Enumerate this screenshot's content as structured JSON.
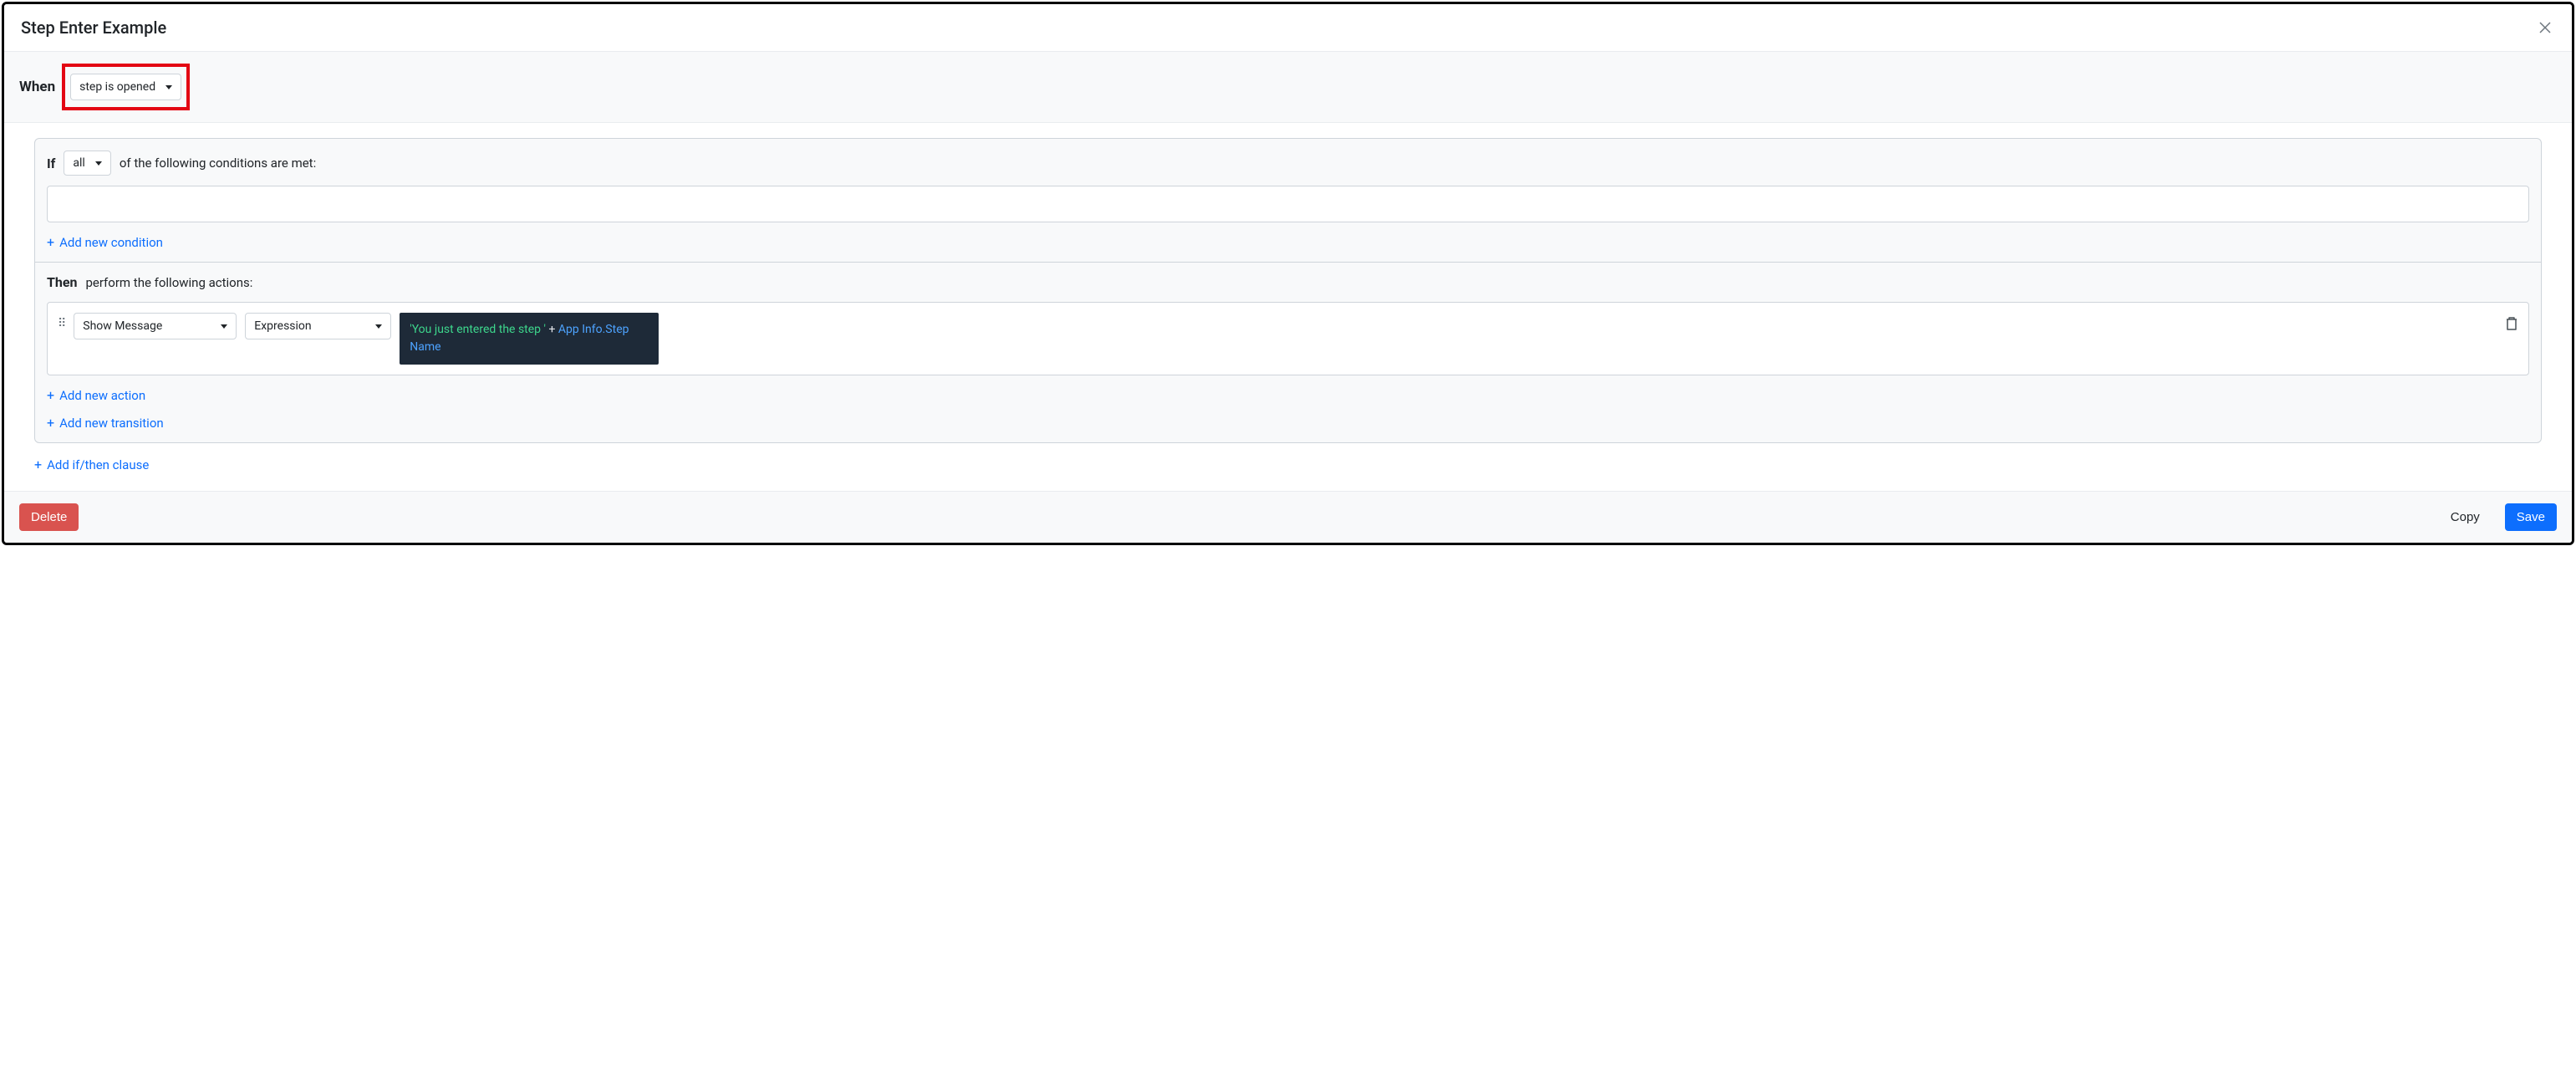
{
  "header": {
    "title": "Step Enter Example"
  },
  "when": {
    "label": "When",
    "trigger": "step is opened"
  },
  "clause": {
    "if_label": "If",
    "if_quantifier": "all",
    "if_suffix": "of the following conditions are met:",
    "add_condition": "Add new condition",
    "then_label": "Then",
    "then_suffix": "perform the following actions:",
    "action": {
      "type": "Show Message",
      "mode": "Expression",
      "expr_string": "'You just entered the step '",
      "expr_op": "+",
      "expr_link": "App Info.Step Name"
    },
    "add_action": "Add new action",
    "add_transition": "Add new transition"
  },
  "add_clause": "Add if/then clause",
  "footer": {
    "delete": "Delete",
    "copy": "Copy",
    "save": "Save"
  }
}
